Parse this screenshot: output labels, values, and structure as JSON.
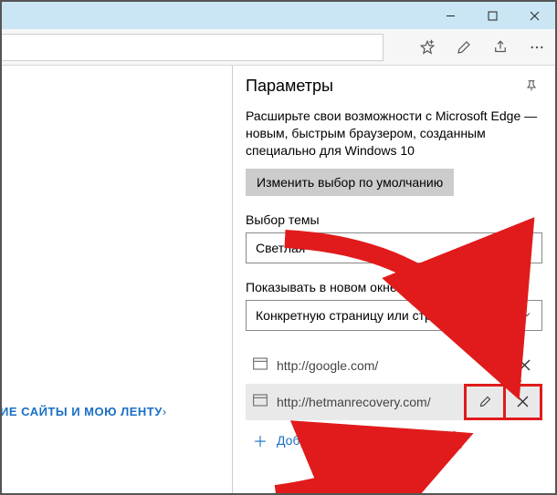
{
  "window": {
    "minimize_label": "Minimize",
    "maximize_label": "Maximize",
    "close_label": "Close"
  },
  "toolbar": {
    "favorites_label": "Favorites",
    "notes_label": "Web Notes",
    "share_label": "Share",
    "more_label": "More"
  },
  "leftpane": {
    "link_text": "ИЕ САЙТЫ И МОЮ ЛЕНТУ",
    "link_chevron": "›"
  },
  "panel": {
    "title": "Параметры",
    "pin_label": "Pin",
    "promo_text": "Расширьте свои возможности с Microsoft Edge — новым, быстрым браузером, созданным специально для Windows 10",
    "default_button": "Изменить выбор по умолчанию",
    "theme": {
      "label": "Выбор темы",
      "value": "Светлая"
    },
    "startup": {
      "label": "Показывать в новом окне Microsoft Edge",
      "value": "Конкретную страницу или страницы"
    },
    "pages": [
      {
        "url": "http://google.com/",
        "edit_visible": false
      },
      {
        "url": "http://hetmanrecovery.com/",
        "edit_visible": true
      }
    ],
    "add_page_label": "Добавить новую страницу"
  }
}
